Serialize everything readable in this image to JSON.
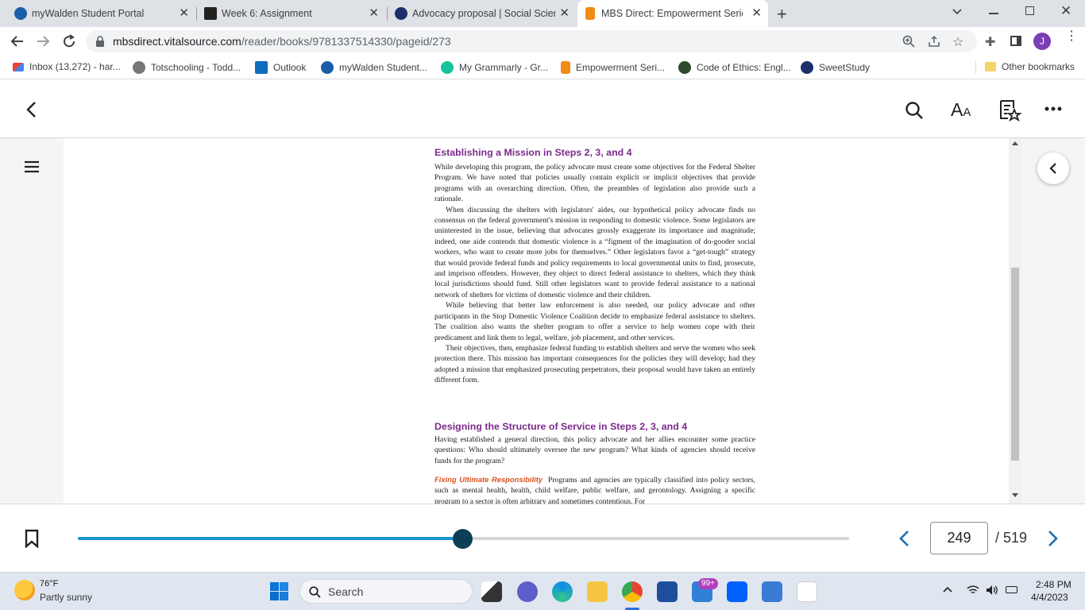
{
  "browser": {
    "tabs": [
      {
        "title": "myWalden Student Portal",
        "active": false
      },
      {
        "title": "Week 6: Assignment",
        "active": false
      },
      {
        "title": "Advocacy proposal | Social Scien",
        "active": false
      },
      {
        "title": "MBS Direct: Empowerment Series",
        "active": true
      }
    ],
    "new_tab": "+",
    "url_host": "mbsdirect.vitalsource.com",
    "url_path": "/reader/books/9781337514330/pageid/273",
    "profile_initial": "J",
    "bookmarks": [
      {
        "label": "Inbox (13,272) - har...",
        "icon": "gmail-icon"
      },
      {
        "label": "Totschooling - Todd...",
        "icon": "totschooling-icon"
      },
      {
        "label": "Outlook",
        "icon": "outlook-icon"
      },
      {
        "label": "myWalden Student...",
        "icon": "walden-icon"
      },
      {
        "label": "My Grammarly - Gr...",
        "icon": "grammarly-icon"
      },
      {
        "label": "Empowerment Seri...",
        "icon": "mbs-icon"
      },
      {
        "label": "Code of Ethics: Engl...",
        "icon": "ethics-icon"
      },
      {
        "label": "SweetStudy",
        "icon": "sweetstudy-icon"
      }
    ],
    "other_bookmarks": "Other bookmarks"
  },
  "book": {
    "heading1": "Establishing a Mission in Steps 2, 3, and 4",
    "para1": "While developing this program, the policy advocate must create some objectives for the Federal Shelter Program. We have noted that policies usually contain explicit or implicit objectives that provide programs with an overarching direction. Often, the preambles of legislation also provide such a rationale.",
    "para2": "When discussing the shelters with legislators' aides, our hypothetical policy advocate finds no consensus on the federal government's mission in responding to domestic violence. Some legislators are uninterested in the issue, believing that advocates grossly exaggerate its importance and magnitude; indeed, one aide contends that domestic violence is a “figment of the imagination of do-gooder social workers, who want to create more jobs for themselves.” Other legislators favor a “get-tough” strategy that would provide federal funds and policy requirements to local governmental units to find, prosecute, and imprison offenders. However, they object to direct federal assistance to shelters, which they think local jurisdictions should fund. Still other legislators want to provide federal assistance to a national network of shelters for victims of domestic violence and their children.",
    "para3": "While believing that better law enforcement is also needed, our policy advocate and other participants in the Stop Domestic Violence Coalition decide to emphasize federal assistance to shelters. The coalition also wants the shelter program to offer a service to help women cope with their predicament and link them to legal, welfare, job placement, and other services.",
    "para4": "Their objectives, then, emphasize federal funding to establish shelters and serve the women who seek protection there. This mission has important consequences for the policies they will develop; had they adopted a mission that emphasized prosecuting perpetrators, their proposal would have taken an entirely different form.",
    "heading2": "Designing the Structure of Service in Steps 2, 3, and 4",
    "para5": "Having established a general direction, this policy advocate and her allies encounter some practice questions: Who should ultimately oversee the new program? What kinds of agencies should receive funds for the program?",
    "runin": "Fixing Ultimate Responsibility",
    "para6": "Programs and agencies are typically classified into policy sectors, such as mental health, health, child welfare, public welfare, and gerontology. Assigning a specific program to a sector is often arbitrary and sometimes contentious. For"
  },
  "footer": {
    "current_page": "249",
    "total_pages": "/ 519",
    "progress": 0.4985
  },
  "taskbar": {
    "weather_temp": "76°F",
    "weather_desc": "Partly sunny",
    "search_placeholder": "Search",
    "mail_badge": "99+",
    "time": "2:48 PM",
    "date": "4/4/2023"
  },
  "colors": {
    "heading": "#7b2a8c",
    "runin": "#d9531e",
    "progress": "#1b95d3",
    "knob": "#0c3f57"
  }
}
